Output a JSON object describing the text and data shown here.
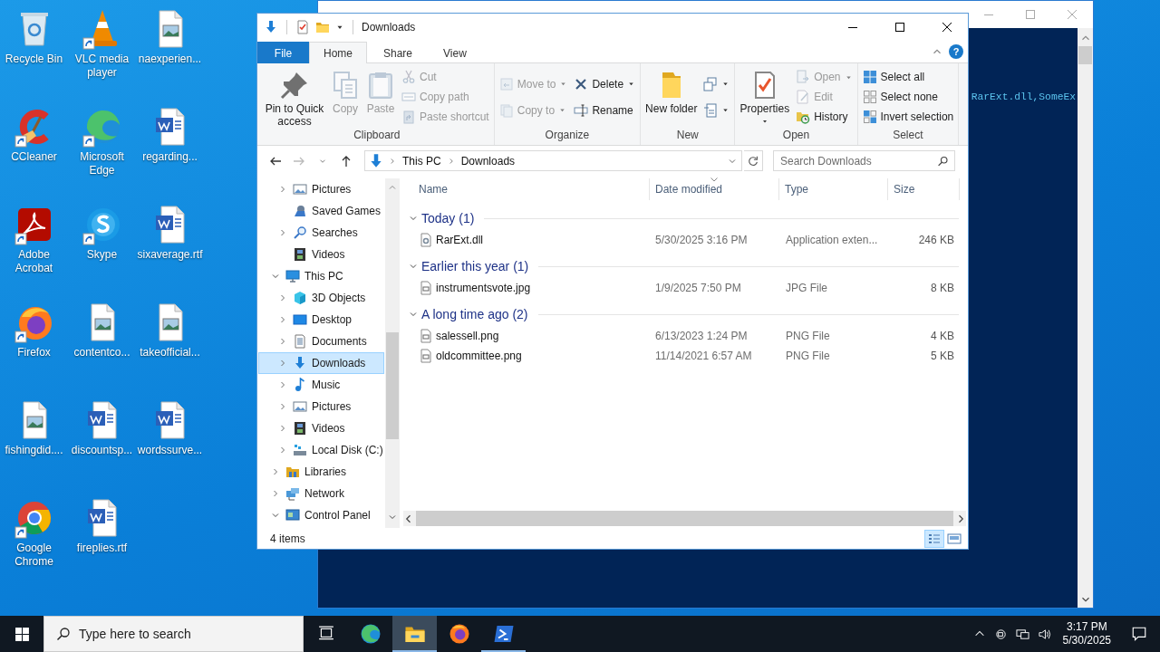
{
  "desktop_icons": [
    {
      "label": "Recycle Bin",
      "kind": "recycle",
      "shortcut": false
    },
    {
      "label": "VLC media player",
      "kind": "vlc",
      "shortcut": true
    },
    {
      "label": "naexperien...",
      "kind": "image_file",
      "shortcut": false
    },
    {
      "label": "CCleaner",
      "kind": "ccleaner",
      "shortcut": true
    },
    {
      "label": "Microsoft Edge",
      "kind": "edge",
      "shortcut": true
    },
    {
      "label": "regarding...",
      "kind": "word_doc",
      "shortcut": false
    },
    {
      "label": "Adobe Acrobat",
      "kind": "acrobat",
      "shortcut": true
    },
    {
      "label": "Skype",
      "kind": "skype",
      "shortcut": true
    },
    {
      "label": "sixaverage.rtf",
      "kind": "word_doc",
      "shortcut": false
    },
    {
      "label": "Firefox",
      "kind": "firefox",
      "shortcut": true
    },
    {
      "label": "contentco...",
      "kind": "image_file",
      "shortcut": false
    },
    {
      "label": "takeofficial...",
      "kind": "image_file",
      "shortcut": false
    },
    {
      "label": "fishingdid....",
      "kind": "image_file",
      "shortcut": false
    },
    {
      "label": "discountsp...",
      "kind": "word_doc",
      "shortcut": false
    },
    {
      "label": "wordssurve...",
      "kind": "word_doc",
      "shortcut": false
    },
    {
      "label": "Google Chrome",
      "kind": "chrome",
      "shortcut": true
    },
    {
      "label": "fireplies.rtf",
      "kind": "word_doc",
      "shortcut": false
    }
  ],
  "console": {
    "output": "RarExt.dll,SomeEx"
  },
  "explorer": {
    "title": "Downloads",
    "ribbon_tabs": [
      {
        "label": "File",
        "kind": "file",
        "selected": false
      },
      {
        "label": "Home",
        "kind": "tab",
        "selected": true
      },
      {
        "label": "Share",
        "kind": "tab",
        "selected": false
      },
      {
        "label": "View",
        "kind": "tab",
        "selected": false
      }
    ],
    "help": "?",
    "ribbon_groups": [
      {
        "label": "Clipboard",
        "columns": [
          [
            {
              "label": "Pin to Quick access",
              "kind": "pin",
              "disabled": false,
              "has_menu": false
            }
          ],
          [
            {
              "label": "Copy",
              "kind": "copy",
              "disabled": true,
              "has_menu": false
            }
          ],
          [
            {
              "label": "Paste",
              "kind": "paste",
              "disabled": true,
              "has_menu": false
            }
          ],
          [
            {
              "label": "Cut",
              "kind": "cut",
              "disabled": true,
              "has_menu": false
            },
            {
              "label": "Copy path",
              "kind": "copy_path",
              "disabled": true,
              "has_menu": false
            },
            {
              "label": "Paste shortcut",
              "kind": "paste_shortcut",
              "disabled": true,
              "has_menu": false
            }
          ]
        ]
      },
      {
        "label": "Organize",
        "columns": [
          [
            {
              "label": "Move to",
              "kind": "move_to",
              "disabled": true,
              "has_menu": true
            },
            {
              "label": "Copy to",
              "kind": "copy_to",
              "disabled": true,
              "has_menu": true
            }
          ],
          [
            {
              "label": "Delete",
              "kind": "delete",
              "disabled": false,
              "has_menu": true
            },
            {
              "label": "Rename",
              "kind": "rename",
              "disabled": false,
              "has_menu": false
            }
          ]
        ]
      },
      {
        "label": "New",
        "columns": [
          [
            {
              "label": "New folder",
              "kind": "new_folder",
              "disabled": false,
              "has_menu": false
            }
          ],
          [
            {
              "kind": "new_item",
              "disabled": false,
              "has_menu": true
            },
            {
              "kind": "easy_access",
              "disabled": false,
              "has_menu": true
            }
          ]
        ]
      },
      {
        "label": "Open",
        "columns": [
          [
            {
              "label": "Properties",
              "kind": "properties",
              "disabled": false,
              "has_menu": true
            }
          ],
          [
            {
              "label": "Open",
              "kind": "open",
              "disabled": true,
              "has_menu": true
            },
            {
              "label": "Edit",
              "kind": "edit",
              "disabled": true,
              "has_menu": false
            },
            {
              "label": "History",
              "kind": "history",
              "disabled": false,
              "has_menu": false
            }
          ]
        ]
      },
      {
        "label": "Select",
        "columns": [
          [
            {
              "label": "Select all",
              "kind": "select_all",
              "disabled": false,
              "has_menu": false
            },
            {
              "label": "Select none",
              "kind": "select_none",
              "disabled": false,
              "has_menu": false
            },
            {
              "label": "Invert selection",
              "kind": "invert_selection",
              "disabled": false,
              "has_menu": false
            }
          ]
        ]
      }
    ],
    "address": {
      "segments": [
        "This PC",
        "Downloads"
      ]
    },
    "search": {
      "placeholder": "Search Downloads"
    },
    "nav_tree": [
      {
        "children": [
          {
            "label": "Pictures",
            "kind": "pictures",
            "expandable": true,
            "expanded": false,
            "selected": false
          },
          {
            "label": "Saved Games",
            "kind": "saved_games",
            "expandable": false,
            "selected": false
          },
          {
            "label": "Searches",
            "kind": "searches",
            "expandable": true,
            "expanded": false,
            "selected": false
          },
          {
            "label": "Videos",
            "kind": "videos",
            "expandable": false,
            "selected": false
          }
        ]
      },
      {
        "label": "This PC",
        "kind": "pc",
        "expandable": true,
        "expanded": true,
        "selected": false,
        "children": [
          {
            "label": "3D Objects",
            "kind": "objects3d",
            "expandable": true,
            "expanded": false,
            "selected": false
          },
          {
            "label": "Desktop",
            "kind": "desktop",
            "expandable": true,
            "expanded": false,
            "selected": false
          },
          {
            "label": "Documents",
            "kind": "documents",
            "expandable": true,
            "expanded": false,
            "selected": false
          },
          {
            "label": "Downloads",
            "kind": "downloads",
            "expandable": true,
            "expanded": false,
            "selected": true
          },
          {
            "label": "Music",
            "kind": "music",
            "expandable": true,
            "expanded": false,
            "selected": false
          },
          {
            "label": "Pictures",
            "kind": "pictures",
            "expandable": true,
            "expanded": false,
            "selected": false
          },
          {
            "label": "Videos",
            "kind": "videos",
            "expandable": true,
            "expanded": false,
            "selected": false
          },
          {
            "label": "Local Disk (C:)",
            "kind": "disk",
            "expandable": true,
            "expanded": false,
            "selected": false
          }
        ]
      },
      {
        "label": "Libraries",
        "kind": "libraries",
        "expandable": true,
        "expanded": false,
        "selected": false
      },
      {
        "label": "Network",
        "kind": "network",
        "expandable": true,
        "expanded": false,
        "selected": false
      },
      {
        "label": "Control Panel",
        "kind": "control_panel",
        "expandable": true,
        "expanded": true,
        "selected": false
      }
    ],
    "columns": [
      {
        "label": "Name",
        "sorted": false
      },
      {
        "label": "Date modified",
        "sorted": true
      },
      {
        "label": "Type",
        "sorted": false
      },
      {
        "label": "Size",
        "sorted": false
      }
    ],
    "groups": [
      {
        "label": "Today (1)",
        "expanded": true,
        "files": [
          {
            "name": "RarExt.dll",
            "kind": "dll",
            "date": "5/30/2025 3:16 PM",
            "type": "Application exten...",
            "size": "246 KB"
          }
        ]
      },
      {
        "label": "Earlier this year (1)",
        "expanded": true,
        "files": [
          {
            "name": "instrumentsvote.jpg",
            "kind": "image",
            "date": "1/9/2025 7:50 PM",
            "type": "JPG File",
            "size": "8 KB"
          }
        ]
      },
      {
        "label": "A long time ago (2)",
        "expanded": true,
        "files": [
          {
            "name": "salessell.png",
            "kind": "image",
            "date": "6/13/2023 1:24 PM",
            "type": "PNG File",
            "size": "4 KB"
          },
          {
            "name": "oldcommittee.png",
            "kind": "image",
            "date": "11/14/2021 6:57 AM",
            "type": "PNG File",
            "size": "5 KB"
          }
        ]
      }
    ],
    "status": "4 items",
    "view_buttons": [
      {
        "kind": "details",
        "selected": true
      },
      {
        "kind": "large_icons",
        "selected": false
      }
    ]
  },
  "taskbar": {
    "search": {
      "placeholder": "Type here to search"
    },
    "apps": [
      {
        "kind": "task_view",
        "selected": false,
        "running": false
      },
      {
        "kind": "edge",
        "selected": false,
        "running": false
      },
      {
        "kind": "explorer",
        "selected": true,
        "running": true
      },
      {
        "kind": "firefox",
        "selected": false,
        "running": false
      },
      {
        "kind": "powershell",
        "selected": false,
        "running": true
      }
    ],
    "time": "3:17 PM",
    "date": "5/30/2025"
  }
}
